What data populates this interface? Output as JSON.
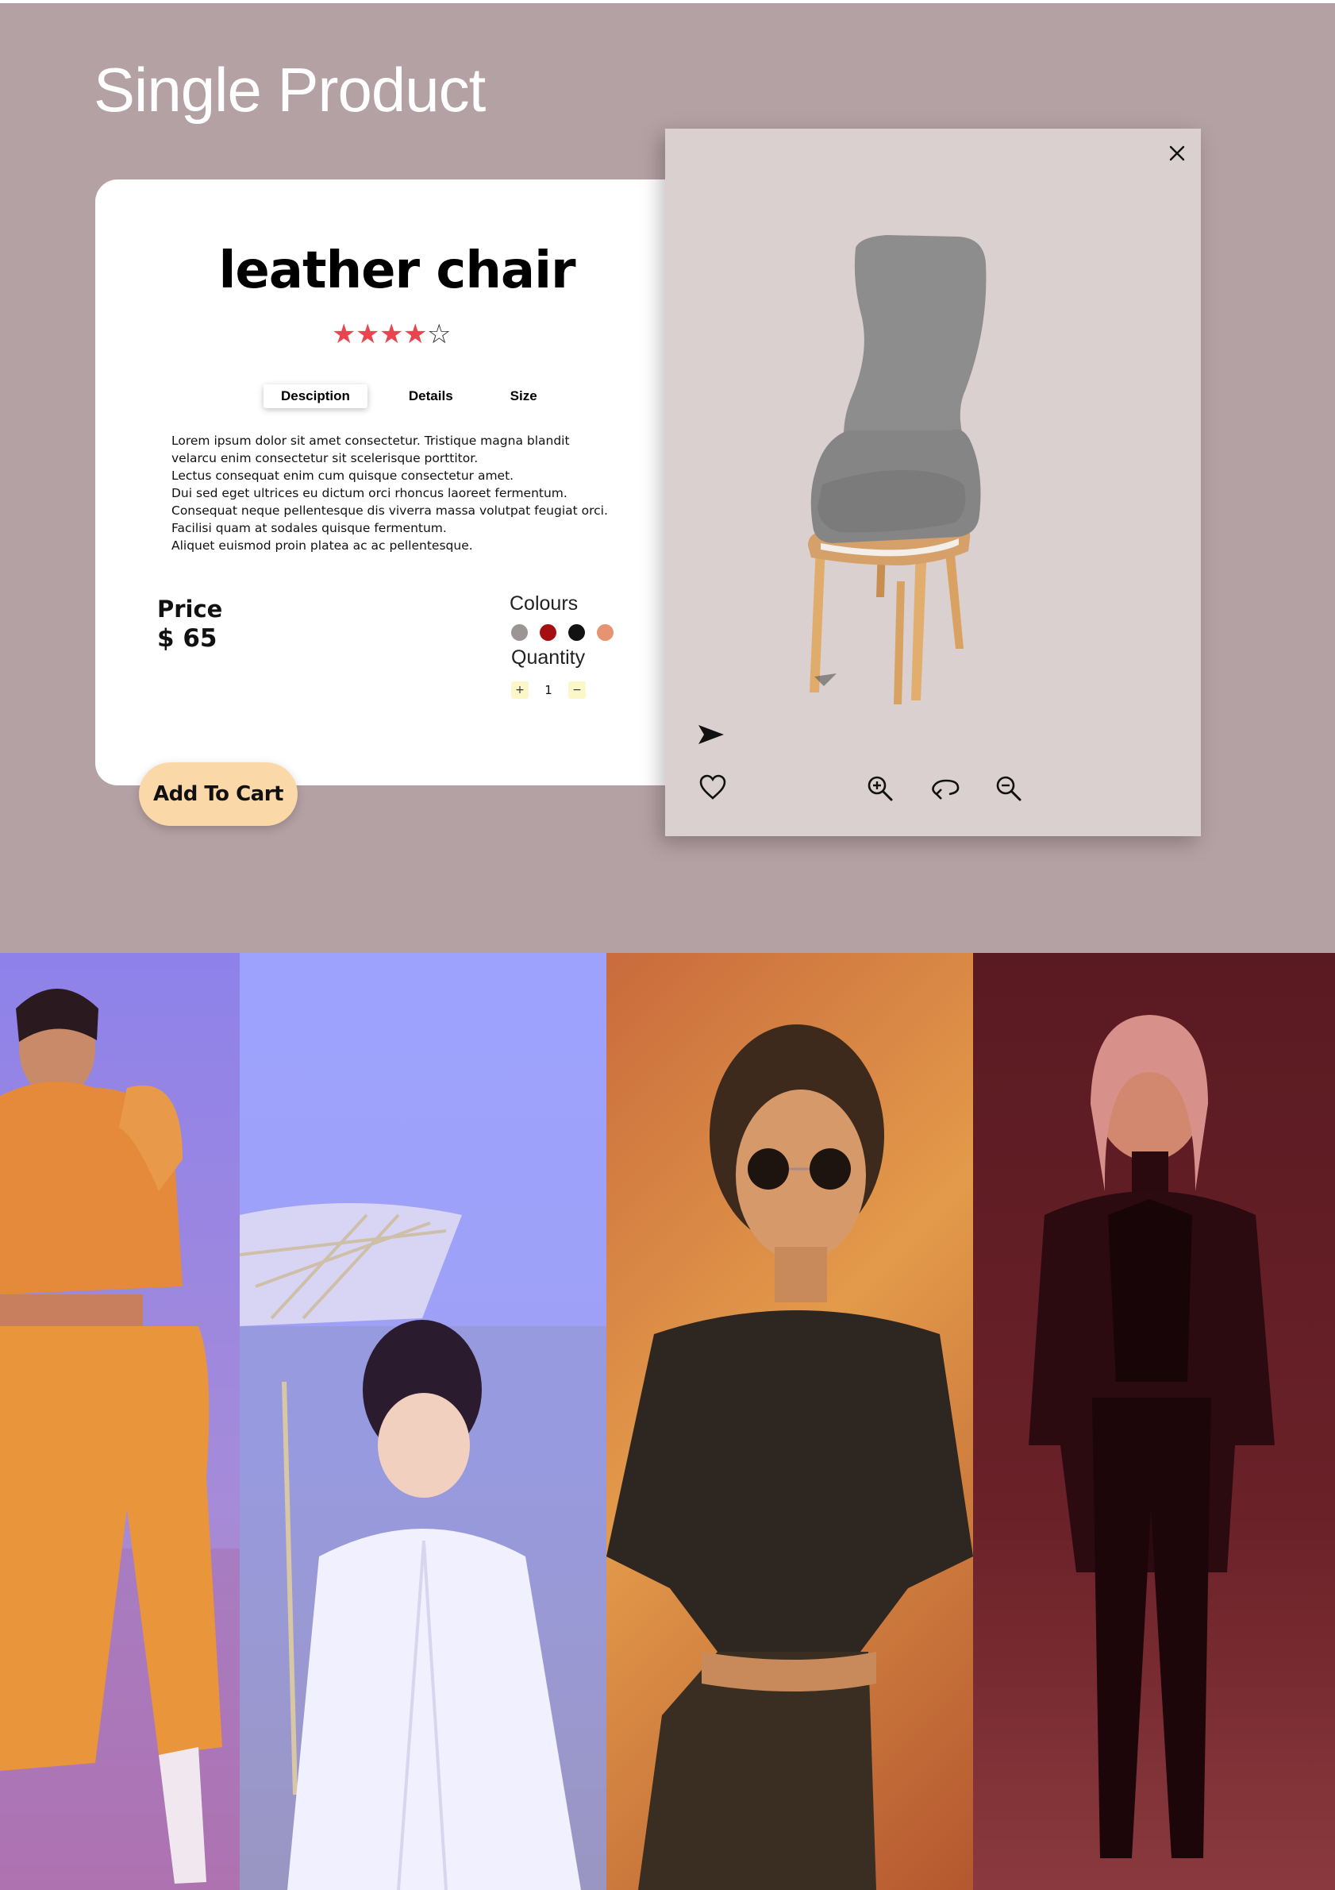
{
  "page": {
    "title": "Single Product"
  },
  "product": {
    "name": "leather chair",
    "rating": 4,
    "rating_max": 5,
    "tabs": [
      {
        "label": "Desciption",
        "active": true
      },
      {
        "label": "Details",
        "active": false
      },
      {
        "label": "Size",
        "active": false
      }
    ],
    "description": [
      "Lorem ipsum dolor sit amet consectetur. Tristique magna blandit",
      "velarcu enim consectetur sit scelerisque porttitor.",
      "Lectus consequat enim cum quisque consectetur amet.",
      "Dui sed eget ultrices eu dictum orci rhoncus laoreet fermentum.",
      "Consequat neque pellentesque dis viverra massa volutpat feugiat orci.",
      "Facilisi quam at sodales quisque fermentum.",
      "Aliquet euismod proin platea ac ac pellentesque."
    ],
    "price_label": "Price",
    "price_value": "$ 65",
    "colours_label": "Colours",
    "colours": [
      "#9b9593",
      "#a50f12",
      "#121212",
      "#e69372"
    ],
    "quantity_label": "Quantity",
    "quantity": "1",
    "qty_plus": "+",
    "qty_minus": "−",
    "add_to_cart": "Add To Cart"
  },
  "viewer": {
    "icons": [
      "close-icon",
      "share-send-icon",
      "heart-icon",
      "zoom-in-icon",
      "rotate-icon",
      "zoom-out-icon"
    ]
  },
  "gallery": {
    "photos": [
      {
        "name": "model-orange-hoodie",
        "overlay": "#8a7fe8"
      },
      {
        "name": "model-parasol",
        "overlay": "#9a9dfb"
      },
      {
        "name": "model-sunglasses",
        "overlay": "#d17a3a"
      },
      {
        "name": "model-black-suit",
        "overlay": "#6b1e28"
      }
    ]
  }
}
